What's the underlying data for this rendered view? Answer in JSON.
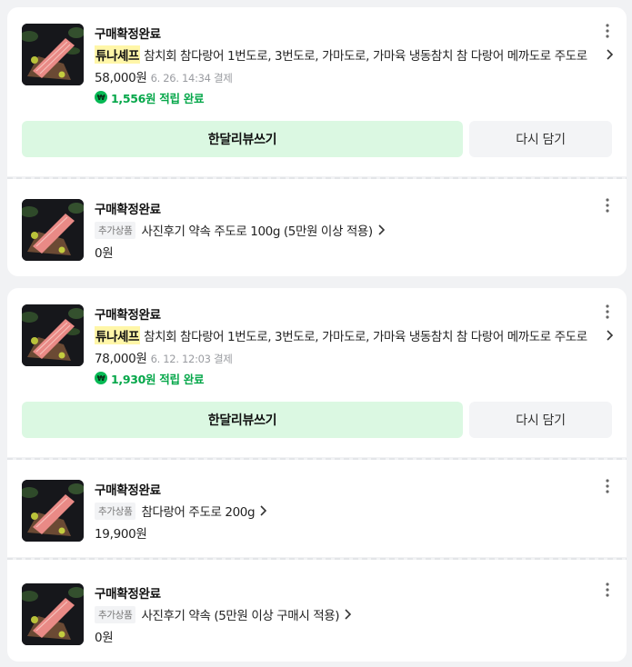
{
  "colors": {
    "page_bg": "#f1f2f4",
    "brand_highlight": "#fff6a8",
    "reward_green": "#06a74a",
    "review_button_bg": "#dbf8e2",
    "cart_button_bg": "#f3f4f6"
  },
  "icons": {
    "more": "kebab-vertical-icon",
    "chevron": "chevron-right-icon",
    "npay_point": "n-point-icon"
  },
  "orders": [
    {
      "status": "구매확정완료",
      "brand": "튜나셰프",
      "title": "참치회 참다랑어 1번도로, 3번도로, 가마도로, 가마육 냉동참치 참 다랑어 메까도로 주도로",
      "price": "58,000원",
      "paid_at": "6. 26. 14:34 결제",
      "reward": "1,556원 적립 완료",
      "review_button": "한달리뷰쓰기",
      "cart_button": "다시 담기"
    },
    {
      "status": "구매확정완료",
      "tag": "추가상품",
      "title": "사진후기 약속 주도로 100g (5만원 이상 적용)",
      "price": "0원"
    },
    {
      "status": "구매확정완료",
      "brand": "튜나셰프",
      "title": "참치회 참다랑어 1번도로, 3번도로, 가마도로, 가마육 냉동참치 참 다랑어 메까도로 주도로",
      "price": "78,000원",
      "paid_at": "6. 12. 12:03 결제",
      "reward": "1,930원 적립 완료",
      "review_button": "한달리뷰쓰기",
      "cart_button": "다시 담기"
    },
    {
      "status": "구매확정완료",
      "tag": "추가상품",
      "title": "참다랑어 주도로 200g",
      "price": "19,900원"
    },
    {
      "status": "구매확정완료",
      "tag": "추가상품",
      "title": "사진후기 약속 (5만원 이상 구매시 적용)",
      "price": "0원"
    }
  ]
}
